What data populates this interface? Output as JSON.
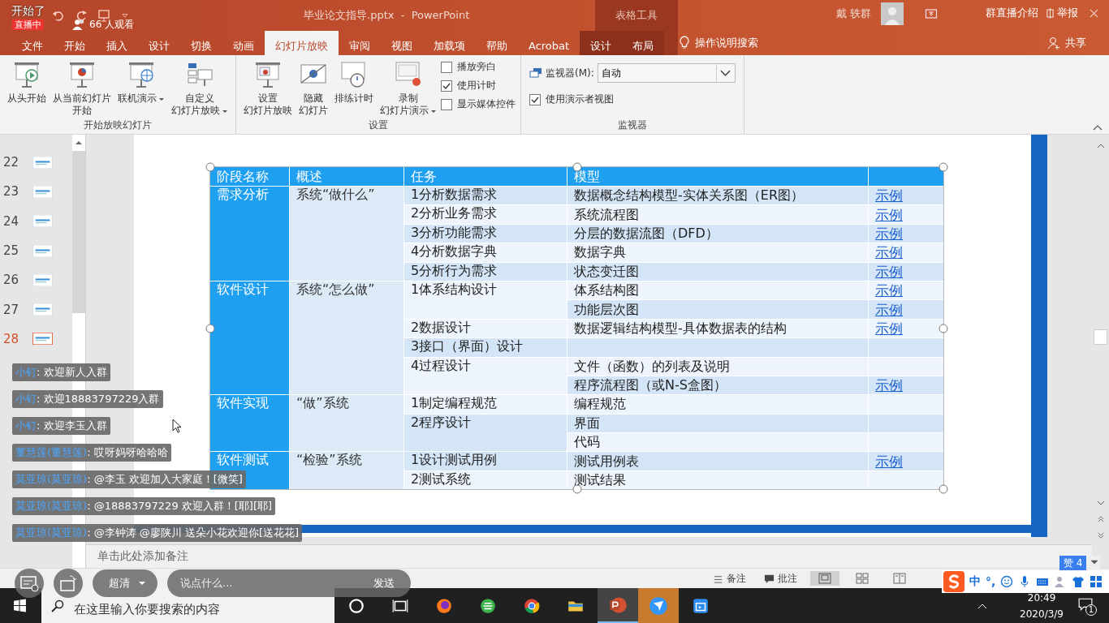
{
  "stream": {
    "banner": "开始了",
    "live_badge": "直播中",
    "viewers": "66 人观看",
    "intro": "群直播介绍",
    "report": "举报",
    "likes": "赞 4",
    "quality": "超清",
    "comment_placeholder": "说点什么...",
    "send": "发送"
  },
  "window": {
    "title": "毕业论文指导.pptx  -  PowerPoint",
    "context_group": "表格工具",
    "user": "戴 轶群"
  },
  "tabs": [
    {
      "label": "文件",
      "selected": false,
      "contextual": false
    },
    {
      "label": "开始",
      "selected": false,
      "contextual": false
    },
    {
      "label": "插入",
      "selected": false,
      "contextual": false
    },
    {
      "label": "设计",
      "selected": false,
      "contextual": false
    },
    {
      "label": "切换",
      "selected": false,
      "contextual": false
    },
    {
      "label": "动画",
      "selected": false,
      "contextual": false
    },
    {
      "label": "幻灯片放映",
      "selected": true,
      "contextual": false
    },
    {
      "label": "审阅",
      "selected": false,
      "contextual": false
    },
    {
      "label": "视图",
      "selected": false,
      "contextual": false
    },
    {
      "label": "加载项",
      "selected": false,
      "contextual": false
    },
    {
      "label": "帮助",
      "selected": false,
      "contextual": false
    },
    {
      "label": "Acrobat",
      "selected": false,
      "contextual": false
    },
    {
      "label": "设计",
      "selected": false,
      "contextual": true
    },
    {
      "label": "布局",
      "selected": false,
      "contextual": true
    }
  ],
  "tell_me": "操作说明搜索",
  "share": "共享",
  "ribbon": [
    {
      "label": "开始放映幻灯片",
      "items": [
        {
          "kind": "large",
          "lines": [
            "从头开始"
          ],
          "dropdown": false
        },
        {
          "kind": "large",
          "lines": [
            "从当前幻灯片",
            "开始"
          ],
          "dropdown": false
        },
        {
          "kind": "large",
          "lines": [
            "联机演示"
          ],
          "dropdown": true
        },
        {
          "kind": "large",
          "lines": [
            "自定义",
            "幻灯片放映"
          ],
          "dropdown": true
        }
      ]
    },
    {
      "label": "设置",
      "items": [
        {
          "kind": "large",
          "lines": [
            "设置",
            "幻灯片放映"
          ],
          "dropdown": false
        },
        {
          "kind": "large",
          "lines": [
            "隐藏",
            "幻灯片"
          ],
          "dropdown": false
        },
        {
          "kind": "large",
          "lines": [
            "排练计时"
          ],
          "dropdown": false
        },
        {
          "kind": "large",
          "lines": [
            "录制",
            "幻灯片演示"
          ],
          "dropdown": true
        },
        {
          "kind": "checks",
          "checks": [
            {
              "label": "播放旁白",
              "checked": false
            },
            {
              "label": "使用计时",
              "checked": true
            },
            {
              "label": "显示媒体控件",
              "checked": false
            }
          ]
        }
      ]
    },
    {
      "label": "监视器",
      "items": [
        {
          "kind": "monitor",
          "label": "监视器(M):",
          "value": "自动",
          "checks": [
            {
              "label": "使用演示者视图",
              "checked": true
            }
          ]
        }
      ]
    }
  ],
  "slides": [
    {
      "number": "22",
      "selected": false
    },
    {
      "number": "23",
      "selected": false
    },
    {
      "number": "24",
      "selected": false
    },
    {
      "number": "25",
      "selected": false
    },
    {
      "number": "26",
      "selected": false
    },
    {
      "number": "27",
      "selected": false
    },
    {
      "number": "28",
      "selected": true
    }
  ],
  "table": {
    "columns": [
      "阶段名称",
      "概述",
      "任务",
      "模型"
    ],
    "stages": [
      {
        "name": "需求分析",
        "summary": "系统“做什么”",
        "tasks": [
          {
            "task": "1分析数据需求",
            "models": [
              {
                "model": "数据概念结构模型-实体关系图（ER图）",
                "link": "示例"
              }
            ]
          },
          {
            "task": "2分析业务需求",
            "models": [
              {
                "model": "系统流程图",
                "link": "示例"
              }
            ]
          },
          {
            "task": "3分析功能需求",
            "models": [
              {
                "model": "分层的数据流图（DFD）",
                "link": "示例"
              }
            ]
          },
          {
            "task": "4分析数据字典",
            "models": [
              {
                "model": "数据字典",
                "link": "示例"
              }
            ]
          },
          {
            "task": "5分析行为需求",
            "models": [
              {
                "model": "状态变迁图",
                "link": "示例"
              }
            ]
          }
        ]
      },
      {
        "name": "软件设计",
        "summary": "系统“怎么做”",
        "tasks": [
          {
            "task": "1体系结构设计",
            "models": [
              {
                "model": "体系结构图",
                "link": "示例"
              },
              {
                "model": "功能层次图",
                "link": "示例"
              }
            ]
          },
          {
            "task": "2数据设计",
            "models": [
              {
                "model": "数据逻辑结构模型-具体数据表的结构",
                "link": "示例"
              }
            ]
          },
          {
            "task": "3接口（界面）设计"
          },
          {
            "task": "4过程设计",
            "models": [
              {
                "model": "文件（函数）的列表及说明"
              },
              {
                "model": "程序流程图（或N-S盒图）",
                "link": "示例"
              }
            ]
          }
        ]
      },
      {
        "name": "软件实现",
        "summary": "“做”系统",
        "tasks": [
          {
            "task": "1制定编程规范",
            "models": [
              {
                "model": "编程规范"
              }
            ]
          },
          {
            "task": "2程序设计",
            "models": [
              {
                "model": "界面"
              },
              {
                "model": "代码"
              }
            ]
          }
        ]
      },
      {
        "name": "软件测试",
        "summary": "“检验”系统",
        "tasks": [
          {
            "task": "1设计测试用例",
            "models": [
              {
                "model": "测试用例表",
                "link": "示例"
              }
            ]
          },
          {
            "task": "2测试系统",
            "models": [
              {
                "model": "测试结果"
              }
            ]
          }
        ]
      }
    ]
  },
  "notes_placeholder": "单击此处添加备注",
  "status_bar": {
    "notes": "备注",
    "comments": "批注"
  },
  "chat": [
    {
      "name": "小钉",
      "text": ": 欢迎新人入群"
    },
    {
      "name": "小钉",
      "text": ": 欢迎18883797229入群"
    },
    {
      "name": "小钉",
      "text": ": 欢迎李玉入群"
    },
    {
      "name": "董慧莲(董慧莲)",
      "text": ": 哎呀妈呀哈哈哈"
    },
    {
      "name": "莫亚琼(莫亚琼)",
      "text": ": @李玉 欢迎加入大家庭！[微笑]"
    },
    {
      "name": "莫亚琼(莫亚琼)",
      "text": ": @18883797229 欢迎入群！[耶][耶]"
    },
    {
      "name": "莫亚琼(莫亚琼)",
      "text": ": @李钟涛 @廖陕川 送朵小花欢迎你[送花花]"
    }
  ],
  "ime": {
    "mode": "中",
    "punct": "°,"
  },
  "taskbar": {
    "search_placeholder": "在这里输入你要搜索的内容",
    "time": "20:49",
    "date": "2020/3/9",
    "notification_count": "1"
  }
}
